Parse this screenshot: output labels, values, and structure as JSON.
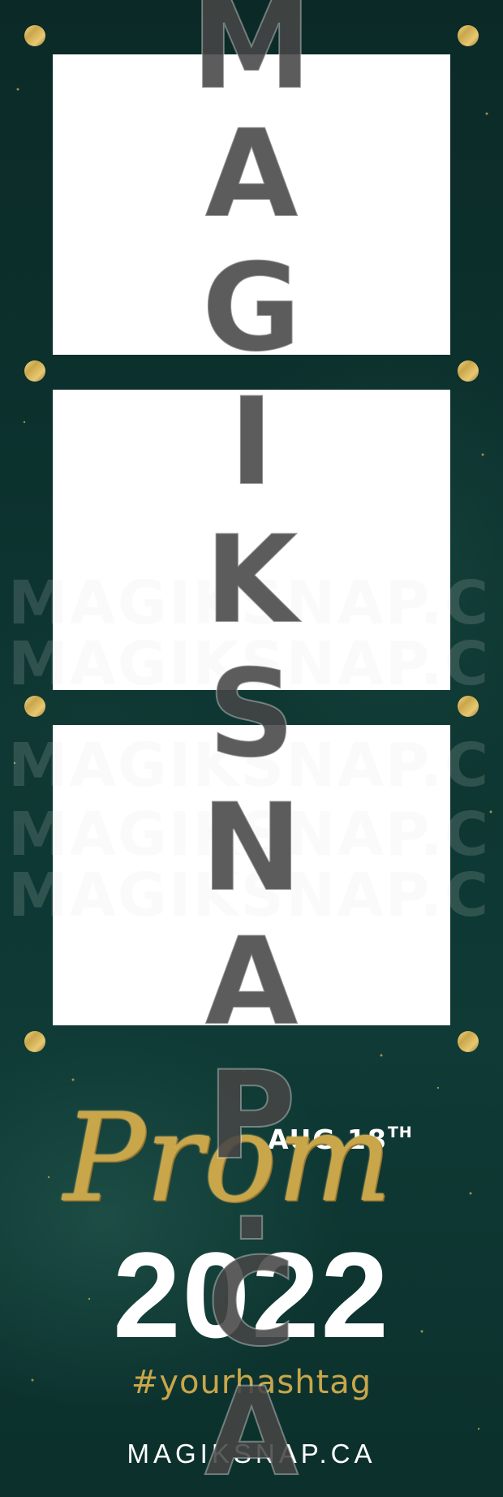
{
  "event": {
    "date": "AUG 18",
    "date_suffix": "TH",
    "title": "Prom",
    "year": "2022",
    "hashtag": "#yourhashtag",
    "brand": "MAGIKSNAP.CA"
  },
  "watermark": {
    "lines": [
      "MAGIKSNAP.C",
      "MAGIKSNAP.C",
      "MAGIKSNAP.C",
      "MAGIKSNAP.C",
      "MAGIKSNAP.C"
    ],
    "vertical_letters": [
      "M",
      "A",
      "G",
      "I",
      "K",
      "S",
      "N",
      "A",
      "P",
      ".",
      "C",
      "A"
    ]
  },
  "colors": {
    "background": "#0c302c",
    "gold": "#c9a64a",
    "text": "#ffffff",
    "photo_slot": "#ffffff"
  }
}
